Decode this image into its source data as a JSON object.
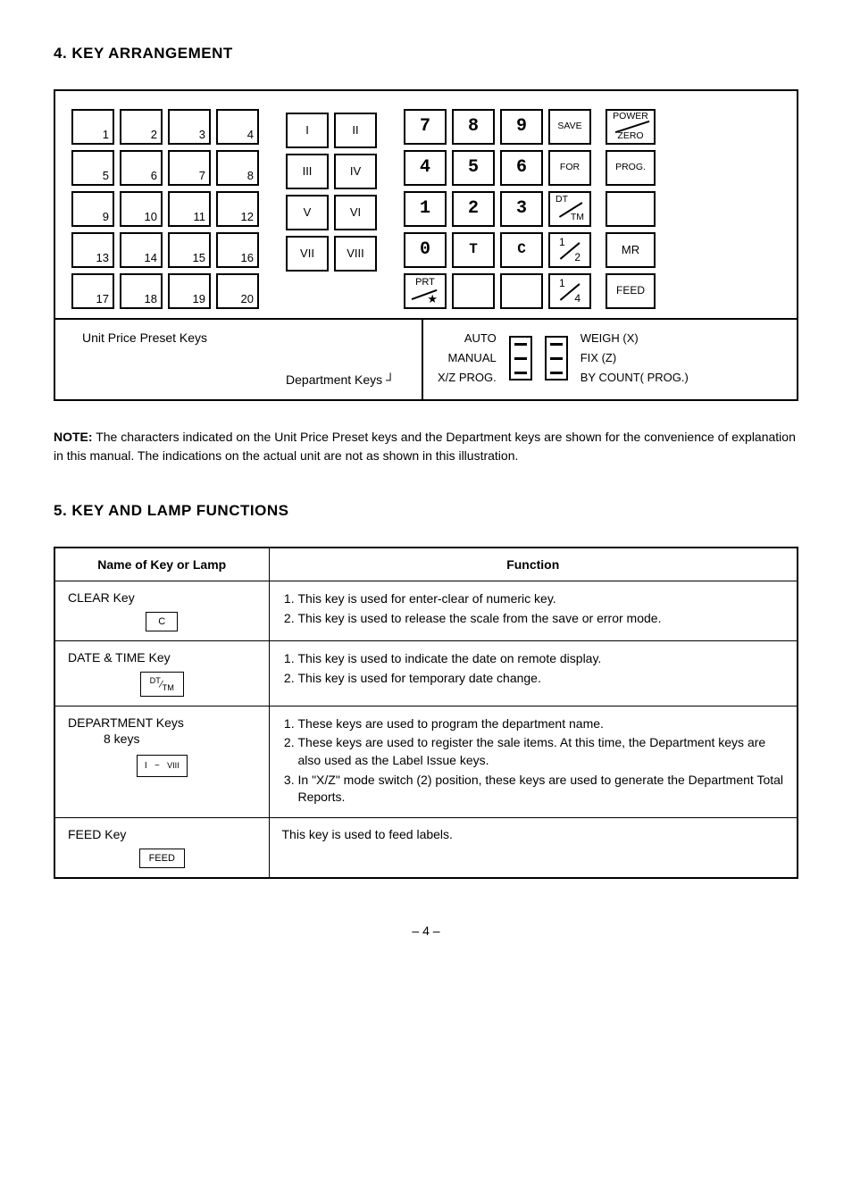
{
  "section4": {
    "heading": "4. KEY ARRANGEMENT"
  },
  "preset_keys": [
    "1",
    "2",
    "3",
    "4",
    "5",
    "6",
    "7",
    "8",
    "9",
    "10",
    "11",
    "12",
    "13",
    "14",
    "15",
    "16",
    "17",
    "18",
    "19",
    "20"
  ],
  "dept_keys": [
    "I",
    "II",
    "III",
    "IV",
    "V",
    "VI",
    "VII",
    "VIII"
  ],
  "numpad": {
    "r0": [
      "7",
      "8",
      "9"
    ],
    "r1": [
      "4",
      "5",
      "6"
    ],
    "r2": [
      "1",
      "2",
      "3"
    ],
    "r3": [
      "0",
      "T",
      "C"
    ]
  },
  "numpad_right": {
    "r0": "SAVE",
    "r1": "FOR"
  },
  "numpad_dttm": {
    "a": "DT",
    "b": "TM"
  },
  "numpad_half": {
    "t": "1",
    "b": "2"
  },
  "numpad_quarter": {
    "t": "1",
    "b": "4"
  },
  "numpad_prt": {
    "a": "PRT",
    "b": "★"
  },
  "funccol": {
    "r0a": "POWER",
    "r0b": "ZERO",
    "r1": "PROG.",
    "r3": "MR",
    "r4": "FEED"
  },
  "legend": {
    "unit_price": "Unit Price Preset Keys",
    "dept": "Department Keys",
    "sw1": {
      "l1": "AUTO",
      "l2": "MANUAL",
      "l3": "X/Z  PROG."
    },
    "sw2": {
      "l1": "WEIGH (X)",
      "l2": "FIX (Z)",
      "l3": "BY  COUNT( PROG.)"
    }
  },
  "note": {
    "label": "NOTE:",
    "text": "The characters indicated on the Unit Price Preset keys and the Department keys are shown for the convenience of explanation in this manual. The indications on the actual unit are not as shown in this illustration."
  },
  "section5": {
    "heading": "5. KEY AND LAMP FUNCTIONS"
  },
  "table": {
    "head": {
      "c1": "Name of Key or Lamp",
      "c2": "Function"
    },
    "rows": [
      {
        "name": "CLEAR Key",
        "cap": "C",
        "fn": [
          "This key is used for enter-clear of numeric key.",
          "This key is used to release the scale from the save or error mode."
        ]
      },
      {
        "name": "DATE & TIME Key",
        "cap": "DT/TM",
        "fn": [
          "This key is used to indicate the date on remote display.",
          "This key is used for temporary date change."
        ]
      },
      {
        "name": "DEPARTMENT Keys",
        "sub": "8 keys",
        "cap": "I   ~   VIII",
        "fn": [
          "These keys are used to program the department name.",
          "These keys are used to register the sale items. At this time, the Department keys are also used as the Label Issue keys.",
          "In \"X/Z\" mode switch (2) position, these keys are used to generate the Department Total Reports."
        ]
      },
      {
        "name": "FEED Key",
        "cap": "FEED",
        "fn_single": "This key is used to feed labels."
      }
    ]
  },
  "pagenum": "– 4 –"
}
